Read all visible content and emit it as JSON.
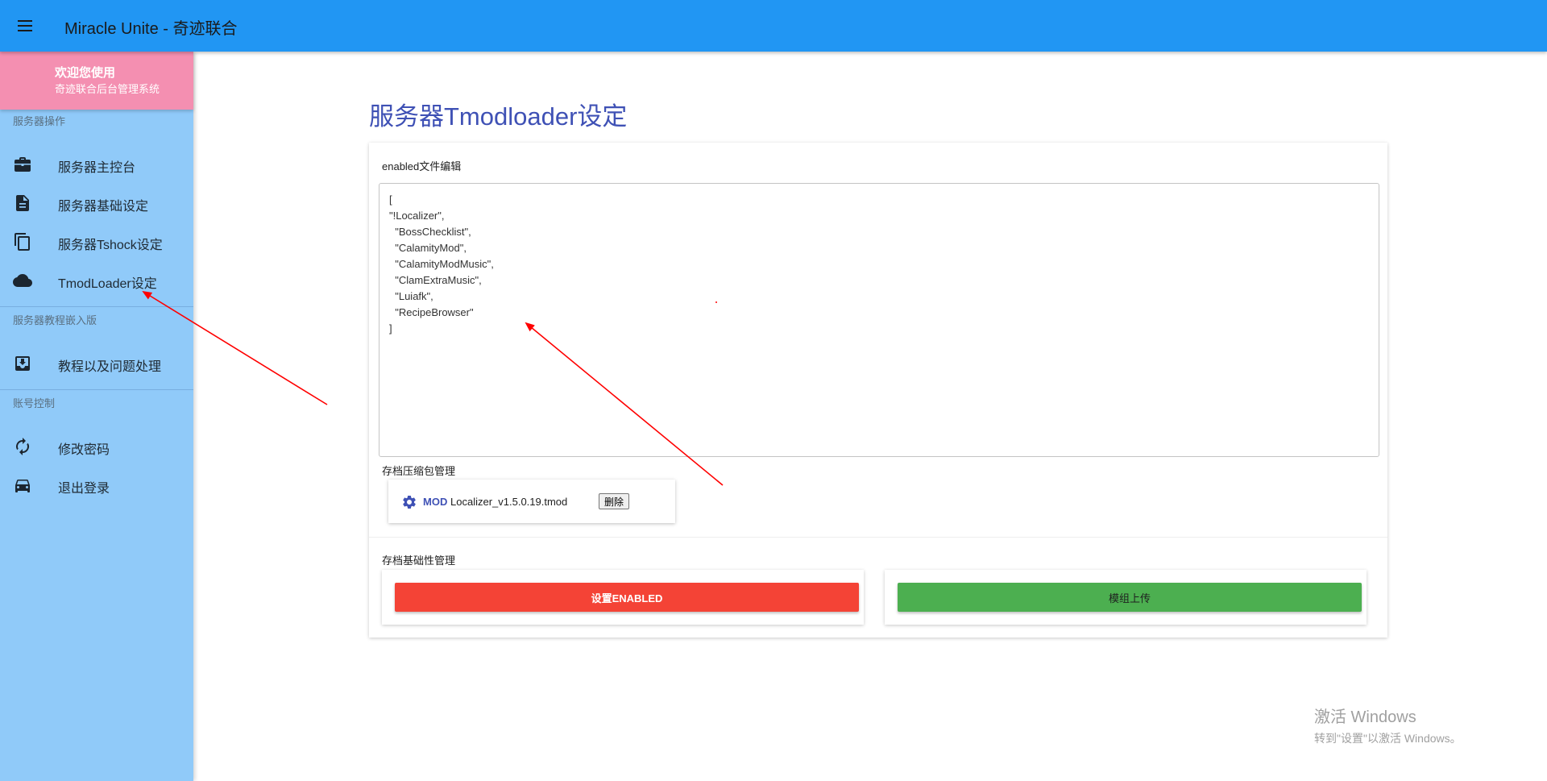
{
  "app": {
    "title": "Miracle Unite - 奇迹联合"
  },
  "drawer": {
    "welcome_title": "欢迎您使用",
    "welcome_subtitle": "奇迹联合后台管理系统",
    "sections": [
      {
        "header": "服务器操作",
        "items": [
          {
            "label": "服务器主控台",
            "icon": "briefcase-icon"
          },
          {
            "label": "服务器基础设定",
            "icon": "document-icon"
          },
          {
            "label": "服务器Tshock设定",
            "icon": "copy-icon"
          },
          {
            "label": "TmodLoader设定",
            "icon": "cloud-icon"
          }
        ]
      },
      {
        "header": "服务器教程嵌入版",
        "items": [
          {
            "label": "教程以及问题处理",
            "icon": "inbox-download-icon"
          }
        ]
      },
      {
        "header": "账号控制",
        "items": [
          {
            "label": "修改密码",
            "icon": "refresh-icon"
          },
          {
            "label": "退出登录",
            "icon": "car-icon"
          }
        ]
      }
    ]
  },
  "main": {
    "page_title": "服务器Tmodloader设定",
    "enabled_label": "enabled文件编辑",
    "enabled_content": "[\n\"!Localizer\",\n  \"BossChecklist\",\n  \"CalamityMod\",\n  \"CalamityModMusic\",\n  \"ClamExtraMusic\",\n  \"Luiafk\",\n  \"RecipeBrowser\"\n]",
    "archive_label": "存档压缩包管理",
    "mod_item": {
      "tag": "MOD",
      "name": "Localizer_v1.5.0.19.tmod",
      "delete_label": "删除"
    },
    "basic_label": "存档基础性管理",
    "set_enabled_button": "设置ENABLED",
    "upload_button": "模组上传"
  },
  "watermark": {
    "title": "激活 Windows",
    "subtitle": "转到\"设置\"以激活 Windows。"
  },
  "colors": {
    "appbar": "#2196f3",
    "drawer": "#90caf9",
    "welcome": "#f48fb1",
    "title_accent": "#3f51b5",
    "danger": "#f44336",
    "success": "#4caf50",
    "annotation": "#ff0000"
  }
}
